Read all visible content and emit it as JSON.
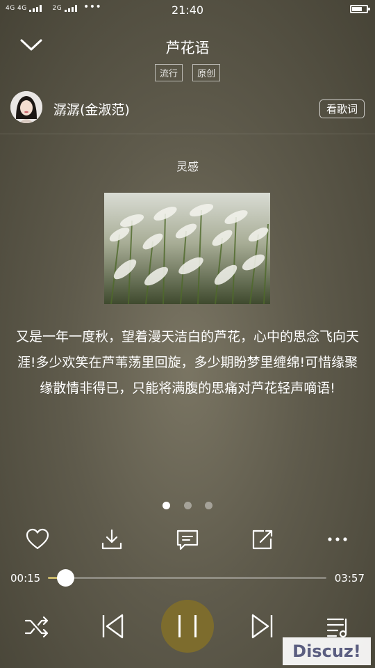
{
  "status_bar": {
    "network": "4G 4G",
    "network2": "2G",
    "time": "21:40"
  },
  "song": {
    "title": "芦花语",
    "tags": [
      "流行",
      "原创"
    ]
  },
  "artist": {
    "name": "潺潺(金淑范)",
    "lyrics_button": "看歌词"
  },
  "inspiration": {
    "title": "灵感",
    "text": "又是一年一度秋，望着漫天洁白的芦花，心中的思念飞向天涯!多少欢笑在芦苇荡里回旋，多少期盼梦里缠绵!可惜缘聚缘散情非得已，只能将满腹的思痛对芦花轻声嘀语!",
    "page_count": 3,
    "active_page": 1
  },
  "actions": [
    "heart-icon",
    "download-icon",
    "comment-icon",
    "share-icon",
    "more-icon"
  ],
  "player": {
    "current_time": "00:15",
    "total_time": "03:57",
    "progress": 0.063
  },
  "controls": [
    "shuffle-icon",
    "previous-icon",
    "pause-icon",
    "next-icon",
    "playlist-icon"
  ],
  "colors": {
    "accent": "#c9b86a",
    "play_button": "#7d6c2d"
  },
  "watermark": "Discuz!"
}
